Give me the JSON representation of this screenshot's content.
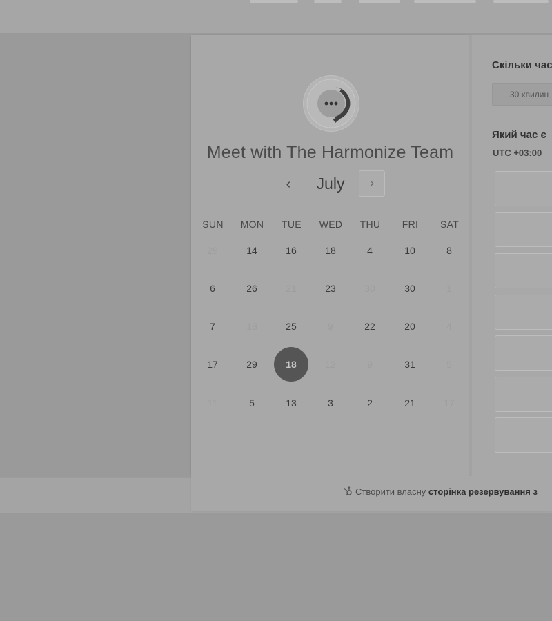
{
  "scheduler": {
    "title": "Meet with The Harmonize Team",
    "month": "July",
    "prev_icon": "‹",
    "next_icon": "›",
    "weekdays": [
      "SUN",
      "MON",
      "TUE",
      "WED",
      "THU",
      "FRI",
      "SAT"
    ],
    "weeks": [
      [
        {
          "d": "29",
          "m": true
        },
        {
          "d": "14"
        },
        {
          "d": "16"
        },
        {
          "d": "18"
        },
        {
          "d": "4"
        },
        {
          "d": "10"
        },
        {
          "d": "8"
        }
      ],
      [
        {
          "d": "6"
        },
        {
          "d": "26"
        },
        {
          "d": "21",
          "m": true
        },
        {
          "d": "23"
        },
        {
          "d": "30",
          "m": true
        },
        {
          "d": "30"
        },
        {
          "d": "1",
          "m": true
        }
      ],
      [
        {
          "d": "7"
        },
        {
          "d": "18",
          "m": true
        },
        {
          "d": "25"
        },
        {
          "d": "9",
          "m": true
        },
        {
          "d": "22"
        },
        {
          "d": "20"
        },
        {
          "d": "4",
          "m": true
        }
      ],
      [
        {
          "d": "17"
        },
        {
          "d": "29"
        },
        {
          "d": "18",
          "s": true
        },
        {
          "d": "12",
          "m": true
        },
        {
          "d": "9",
          "m": true
        },
        {
          "d": "31"
        },
        {
          "d": "5",
          "m": true
        }
      ],
      [
        {
          "d": "11",
          "m": true
        },
        {
          "d": "5"
        },
        {
          "d": "13"
        },
        {
          "d": "3"
        },
        {
          "d": "2"
        },
        {
          "d": "21"
        },
        {
          "d": "17",
          "m": true
        }
      ]
    ]
  },
  "right_panel": {
    "duration_heading": "Скільки час",
    "duration_option": "30 хвилин",
    "time_heading": "Який час є",
    "timezone": "UTC +03:00"
  },
  "footer": {
    "text_prefix": "Створити власну",
    "text_bold": "сторінка резервування з"
  },
  "icons": {
    "avatar": "chat-bubble-icon",
    "footer": "hubspot-sprocket-icon"
  },
  "colors": {
    "selected_day": "#555555",
    "background_overlay": "#9a9a9a"
  }
}
